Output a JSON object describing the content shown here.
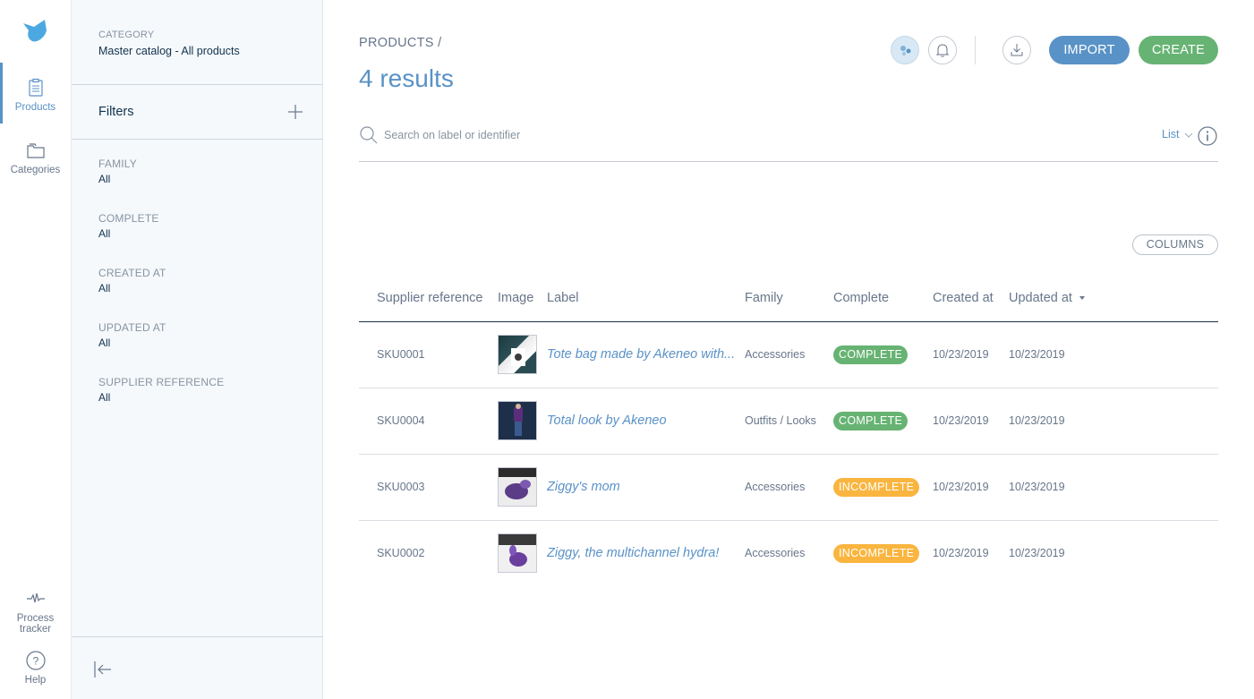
{
  "nav": {
    "items": [
      {
        "label": "Products",
        "icon": "clipboard-icon",
        "active": true
      },
      {
        "label": "Categories",
        "icon": "folder-icon",
        "active": false
      },
      {
        "label": "Process tracker",
        "icon": "activity-icon",
        "active": false
      },
      {
        "label": "Help",
        "icon": "help-icon",
        "active": false
      }
    ]
  },
  "panel": {
    "category_label": "CATEGORY",
    "category_value": "Master catalog - All products",
    "filters_title": "Filters",
    "filters": [
      {
        "label": "FAMILY",
        "value": "All"
      },
      {
        "label": "COMPLETE",
        "value": "All"
      },
      {
        "label": "CREATED AT",
        "value": "All"
      },
      {
        "label": "UPDATED AT",
        "value": "All"
      },
      {
        "label": "SUPPLIER REFERENCE",
        "value": "All"
      }
    ]
  },
  "header": {
    "breadcrumb": "PRODUCTS /",
    "results": "4 results",
    "import_label": "IMPORT",
    "create_label": "CREATE"
  },
  "search": {
    "placeholder": "Search on label or identifier",
    "view_label": "List"
  },
  "table": {
    "columns_button": "COLUMNS",
    "headers": [
      "Supplier reference",
      "Image",
      "Label",
      "Family",
      "Complete",
      "Created at",
      "Updated at"
    ],
    "rows": [
      {
        "sku": "SKU0001",
        "label": "Tote bag made by Akeneo with...",
        "family": "Accessories",
        "complete": "COMPLETE",
        "status": "complete",
        "created": "10/23/2019",
        "updated": "10/23/2019"
      },
      {
        "sku": "SKU0004",
        "label": "Total look by Akeneo",
        "family": "Outfits / Looks",
        "complete": "COMPLETE",
        "status": "complete",
        "created": "10/23/2019",
        "updated": "10/23/2019"
      },
      {
        "sku": "SKU0003",
        "label": "Ziggy's mom",
        "family": "Accessories",
        "complete": "INCOMPLETE",
        "status": "incomplete",
        "created": "10/23/2019",
        "updated": "10/23/2019"
      },
      {
        "sku": "SKU0002",
        "label": "Ziggy, the multichannel hydra!",
        "family": "Accessories",
        "complete": "INCOMPLETE",
        "status": "incomplete",
        "created": "10/23/2019",
        "updated": "10/23/2019"
      }
    ]
  },
  "colors": {
    "accent": "#5992c7",
    "success": "#67b373",
    "warning": "#f9b53f",
    "text": "#11324d",
    "muted": "#67768a"
  }
}
